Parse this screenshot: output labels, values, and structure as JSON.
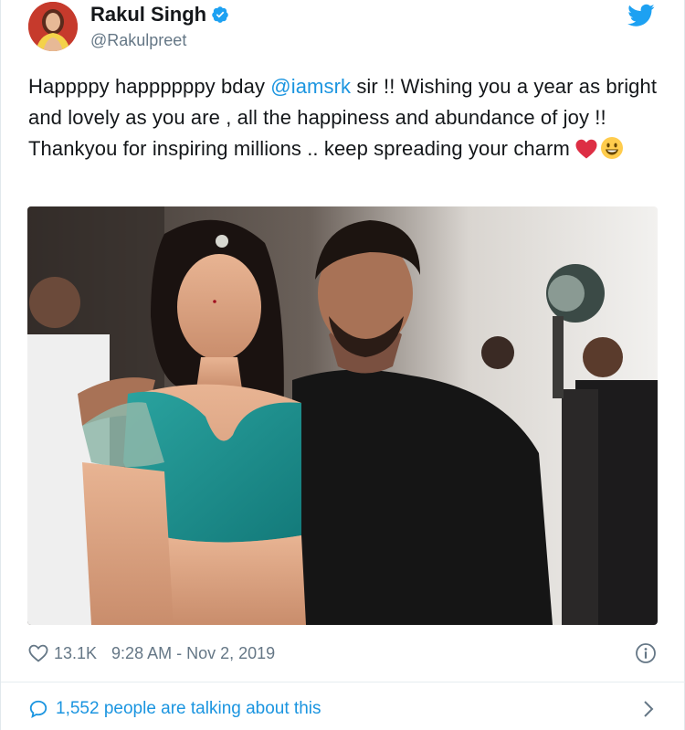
{
  "author": {
    "display_name": "Rakul Singh",
    "handle": "@Rakulpreet",
    "verified": true,
    "avatar_icon": "profile-avatar"
  },
  "tweet": {
    "text_part1": "Happppy happppppy bday ",
    "mention": "@iamsrk",
    "text_part2": " sir !! Wishing you a year as bright and lovely as you are , all the happiness and abundance of joy !! Thankyou for inspiring millions .. keep spreading your charm ",
    "emojis": [
      "red-heart-emoji",
      "smiling-face-emoji"
    ]
  },
  "photo": {
    "icon": "tweet-photo"
  },
  "meta": {
    "likes": "13.1K",
    "timestamp": "9:28 AM - Nov 2, 2019"
  },
  "footer": {
    "talking": "1,552 people are talking about this"
  },
  "colors": {
    "link": "#1b95e0",
    "secondary_text": "#657786",
    "heart_emoji": "#dd2e44",
    "twitter_blue": "#1da1f2"
  }
}
